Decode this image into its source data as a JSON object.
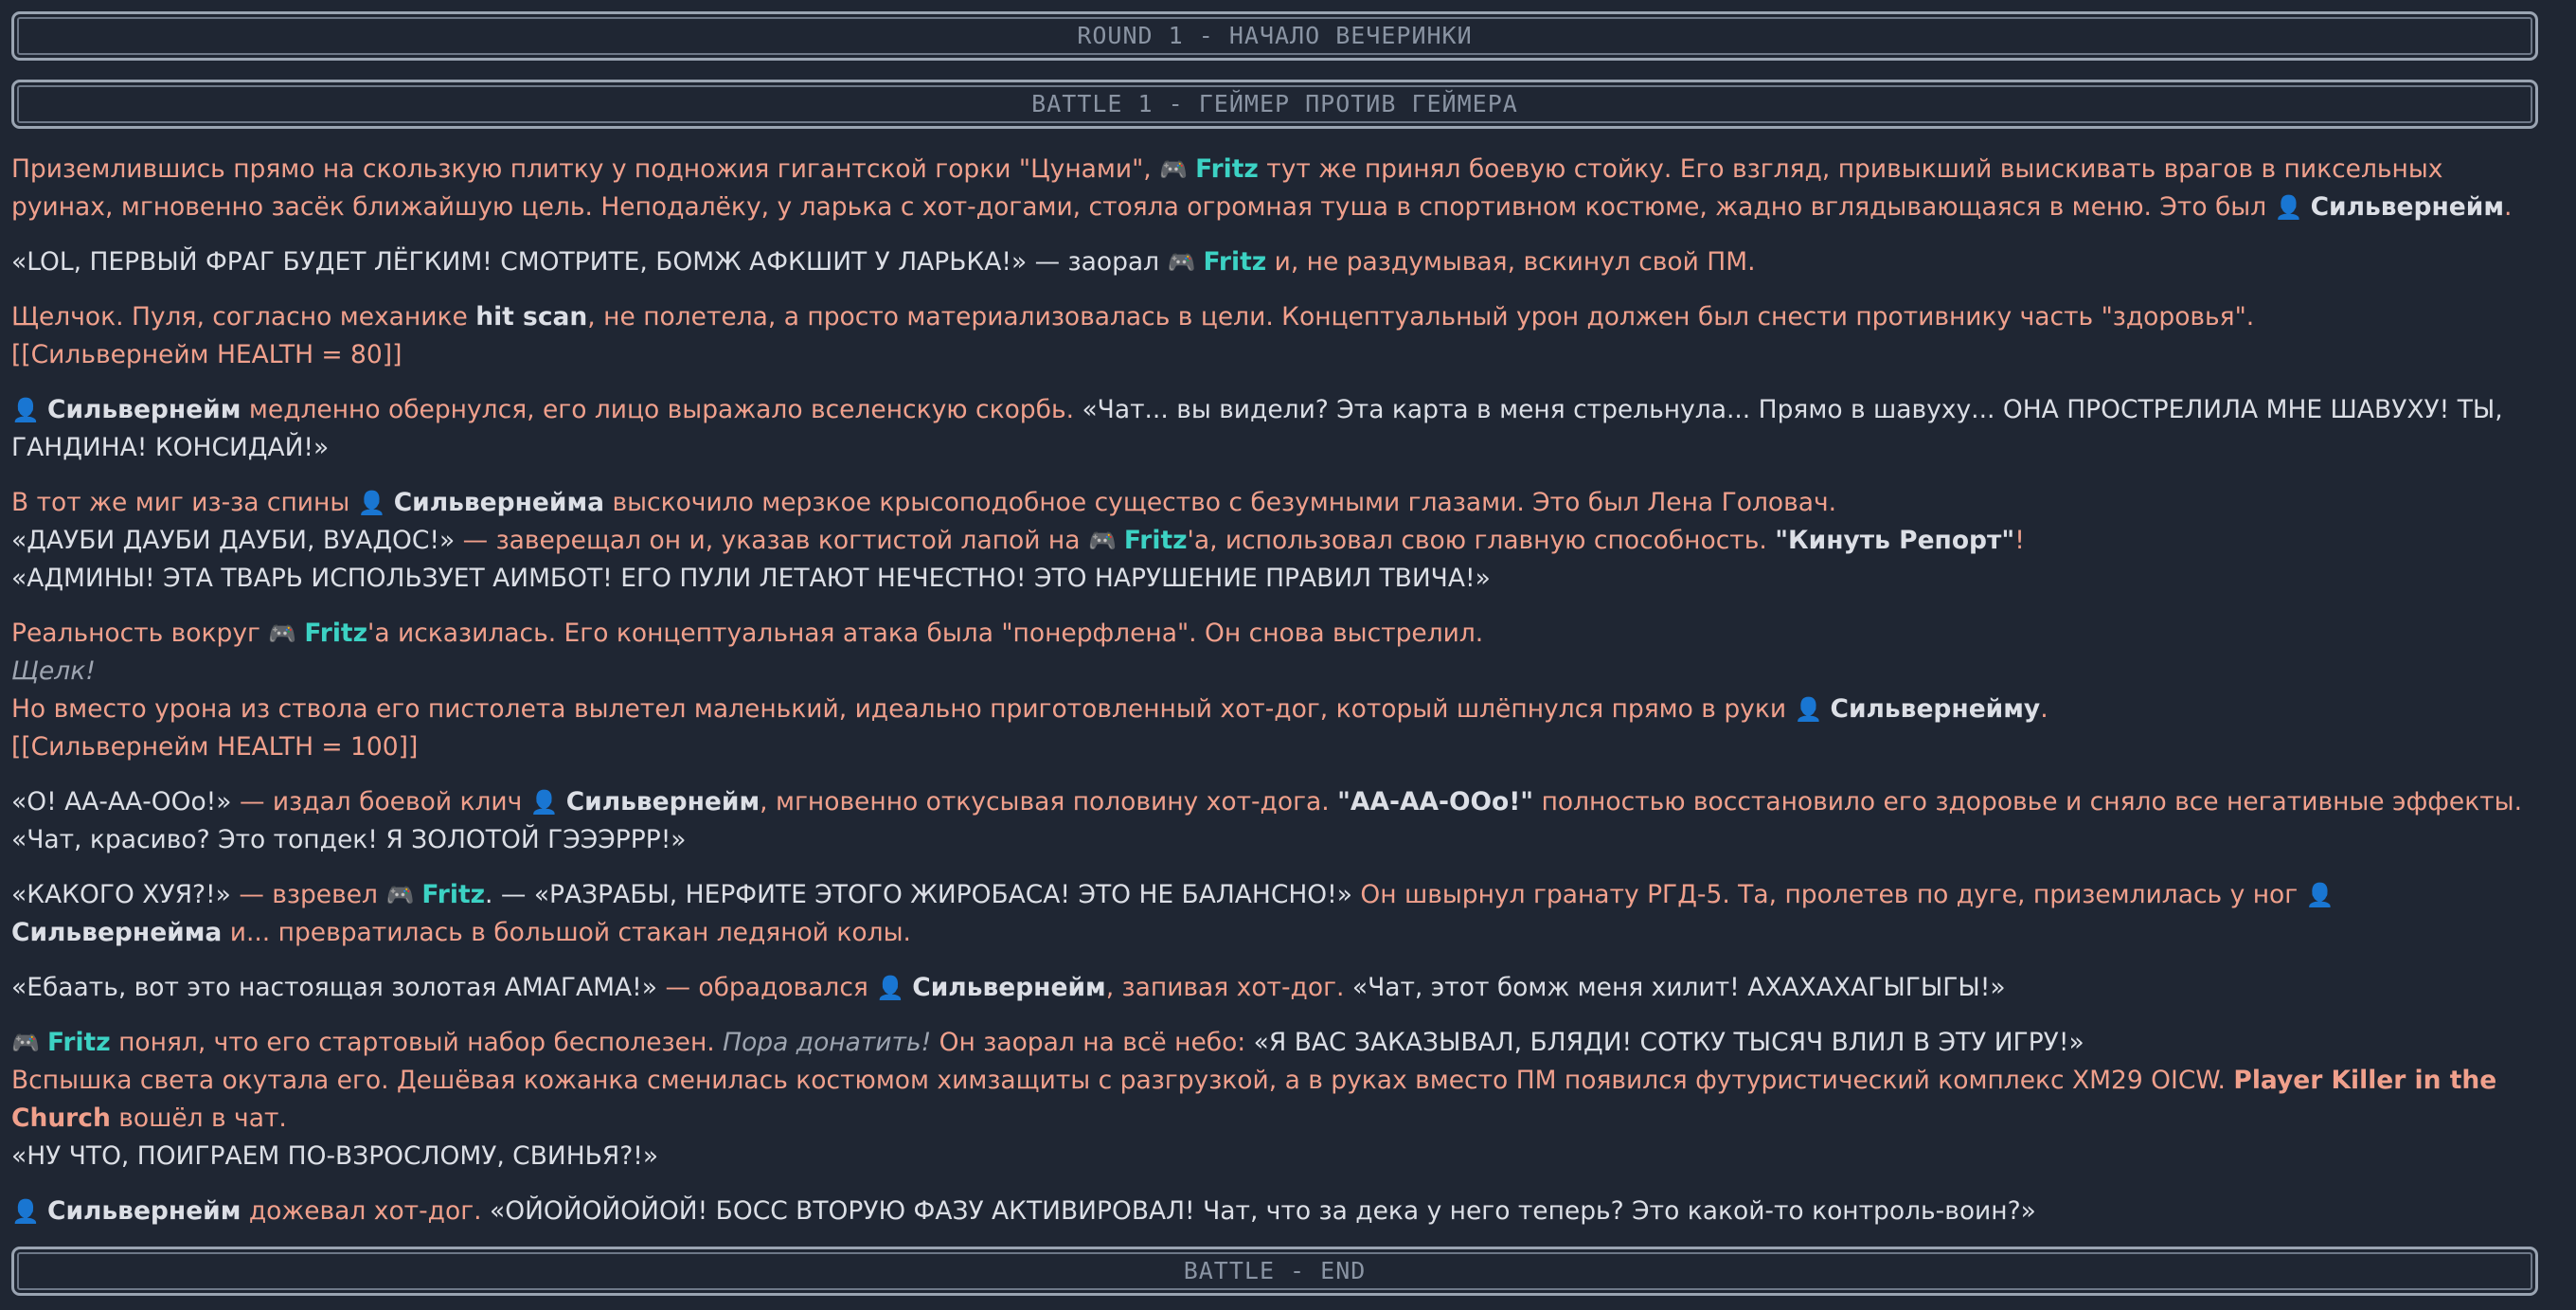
{
  "banners": {
    "round": "ROUND 1 - НАЧАЛО ВЕЧЕРИНКИ",
    "battle": "BATTLE 1 - ГЕЙМЕР ПРОТИВ ГЕЙМЕРА",
    "end": "BATTLE - END"
  },
  "names": {
    "fritz": "Fritz",
    "silvernejm": "Сильвернейм"
  },
  "icons": {
    "fritz_icon": "gamepad-icon",
    "silvernejm_icon": "hooded-person-icon"
  },
  "colors": {
    "background": "#1f2633",
    "narration": "#f0a08c",
    "speech": "#dcdfe6",
    "fritz": "#3cd2c4",
    "banner_text": "#8a94a3"
  },
  "story": {
    "p1": {
      "a": "Приземлившись прямо на скользкую плитку у подножия гигантской горки \"Цунами\",",
      "b": "тут же принял боевую стойку. Его взгляд, привыкший выискивать врагов в пиксельных руинах, мгновенно засёк ближайшую цель. Неподалёку, у ларька с хот-догами, стояла огромная туша в спортивном костюме, жадно вглядывающаяся в меню. Это был",
      "c": "Сильвернейм",
      "d": "."
    },
    "p2": {
      "a": "«LOL, ПЕРВЫЙ ФРАГ БУДЕТ ЛЁГКИМ! СМОТРИТЕ, БОМЖ АФКШИТ У ЛАРЬКА!» — заорал",
      "b": "и, не раздумывая, вскинул свой ПМ."
    },
    "p3": {
      "a": "Щелчок. Пуля, согласно механике",
      "b": "hit scan",
      "c": ", не полетела, а просто материализовалась в цели. Концептуальный урон должен был снести противнику часть \"здоровья\".",
      "status": "[[Сильвернейм HEALTH = 80]]"
    },
    "p4": {
      "a": "Сильвернейм",
      "b": "медленно обернулся, его лицо выражало вселенскую скорбь.",
      "c": "«Чат... вы видели? Эта карта в меня стрельнула... Прямо в шавуху... ОНА ПРОСТРЕЛИЛА МНЕ ШАВУХУ! ТЫ, ГАНДИНА! КОНСИДАЙ!»"
    },
    "p5": {
      "a": "В тот же миг из-за спины",
      "b": "Сильвернейма",
      "c": "выскочило мерзкое крысоподобное существо с безумными глазами. Это был Лена Головач.",
      "d": "«ДАУБИ ДАУБИ ДАУБИ, ВУАДОС!»",
      "e": "— заверещал он и, указав когтистой лапой на",
      "f": "'а, использовал свою главную способность.",
      "g": "\"Кинуть Репорт\"",
      "h": "!",
      "i": "«АДМИНЫ! ЭТА ТВАРЬ ИСПОЛЬЗУЕТ АИМБОТ! ЕГО ПУЛИ ЛЕТАЮТ НЕЧЕСТНО! ЭТО НАРУШЕНИЕ ПРАВИЛ ТВИЧА!»"
    },
    "p6": {
      "a": "Реальность вокруг",
      "b": "'а исказилась. Его концептуальная атака была \"понерфлена\". Он снова выстрелил.",
      "c": "Щелк!",
      "d": "Но вместо урона из ствола его пистолета вылетел маленький, идеально приготовленный хот-дог, который шлёпнулся прямо в руки",
      "e": "Сильвернейму",
      "f": ".",
      "status": "[[Сильвернейм HEALTH = 100]]"
    },
    "p7": {
      "a": "«О! АА-АА-ООо!»",
      "b": "— издал боевой клич",
      "c": "Сильвернейм",
      "d": ", мгновенно откусывая половину хот-дога.",
      "e": "\"АА-АА-ООо!\"",
      "f": "полностью восстановило его здоровье и сняло все негативные эффекты.",
      "g": "«Чат, красиво? Это топдек! Я ЗОЛОТОЙ ГЭЭЭРРР!»"
    },
    "p8": {
      "a": "«КАКОГО ХУЯ?!»",
      "b": "— взревел",
      "c": ". — «РАЗРАБЫ, НЕРФИТЕ ЭТОГО ЖИРОБАСА! ЭТО НЕ БАЛАНСНО!»",
      "d": "Он швырнул гранату РГД-5. Та, пролетев по дуге, приземлилась у ног",
      "e": "Сильвернейма",
      "f": "и... превратилась в большой стакан ледяной колы."
    },
    "p9": {
      "a": "«Ебаать, вот это настоящая золотая АМАГАМА!»",
      "b": "— обрадовался",
      "c": "Сильвернейм",
      "d": ", запивая хот-дог.",
      "e": "«Чат, этот бомж меня хилит! АХАХАХАГЫГЫГЫ!»"
    },
    "p10": {
      "a": "понял, что его стартовый набор бесполезен.",
      "b": "Пора донатить!",
      "c": "Он заорал на всё небо:",
      "d": "«Я ВАС ЗАКАЗЫВАЛ, БЛЯДИ! СОТКУ ТЫСЯЧ ВЛИЛ В ЭТУ ИГРУ!»",
      "e": "Вспышка света окутала его. Дешёвая кожанка сменилась костюмом химзащиты с разгрузкой, а в руках вместо ПМ появился футуристический комплекс XM29 OICW.",
      "f": "Player Killer in the Church",
      "g": "вошёл в чат.",
      "h": "«НУ ЧТО, ПОИГРАЕМ ПО-ВЗРОСЛОМУ, СВИНЬЯ?!»"
    },
    "p11": {
      "a": "Сильвернейм",
      "b": "дожевал хот-дог.",
      "c": "«ОЙОЙОЙОЙОЙ! БОСС ВТОРУЮ ФАЗУ АКТИВИРОВАЛ! Чат, что за дека у него теперь? Это какой-то контроль-воин?»"
    }
  }
}
